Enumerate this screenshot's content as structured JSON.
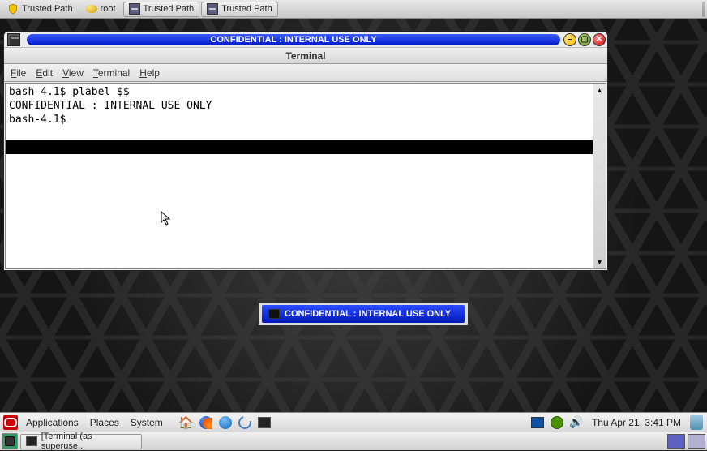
{
  "topbar": {
    "items": [
      {
        "label": "Trusted Path"
      },
      {
        "label": "root"
      },
      {
        "label": "Trusted Path"
      },
      {
        "label": "Trusted Path"
      }
    ]
  },
  "window": {
    "security_label": "CONFIDENTIAL : INTERNAL USE ONLY",
    "title": "Terminal",
    "menu": {
      "file": "File",
      "edit": "Edit",
      "view": "View",
      "terminal": "Terminal",
      "help": "Help"
    }
  },
  "terminal": {
    "lines": [
      "bash-4.1$ plabel $$",
      "CONFIDENTIAL : INTERNAL USE ONLY",
      "bash-4.1$ "
    ]
  },
  "floating_label": "CONFIDENTIAL : INTERNAL USE ONLY",
  "panel_top": {
    "applications": "Applications",
    "places": "Places",
    "system": "System",
    "datetime": "Thu Apr 21,  3:41 PM"
  },
  "panel_bottom": {
    "task": "[Terminal (as superuse..."
  }
}
